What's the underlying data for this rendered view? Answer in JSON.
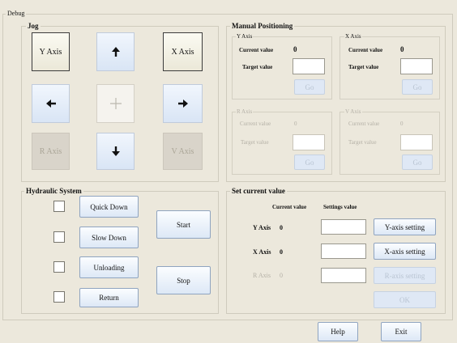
{
  "debug": {
    "title": "Debug"
  },
  "jog": {
    "title": "Jog",
    "y_axis": "Y Axis",
    "x_axis": "X Axis",
    "r_axis": "R Axis",
    "v_axis": "V Axis",
    "up_icon": "arrow-up-icon",
    "left_icon": "arrow-left-icon",
    "center_icon": "plus-icon",
    "right_icon": "arrow-right-icon",
    "down_icon": "arrow-down-icon"
  },
  "manual": {
    "title": "Manual Positioning",
    "y": {
      "title": "Y Axis",
      "current_label": "Current value",
      "current_value": "0",
      "target_label": "Target value",
      "target_value": "",
      "go": "Go"
    },
    "x": {
      "title": "X Axis",
      "current_label": "Current value",
      "current_value": "0",
      "target_label": "Target value",
      "target_value": "",
      "go": "Go"
    },
    "r": {
      "title": "R Axis",
      "current_label": "Current value",
      "current_value": "0",
      "target_label": "Target value",
      "target_value": "",
      "go": "Go"
    },
    "v": {
      "title": "V Axis",
      "current_label": "Current value",
      "current_value": "0",
      "target_label": "Target value",
      "target_value": "",
      "go": "Go"
    }
  },
  "hydraulic": {
    "title": "Hydraulic System",
    "quick_down": "Quick Down",
    "slow_down": "Slow Down",
    "unloading": "Unloading",
    "return": "Return",
    "start": "Start",
    "stop": "Stop"
  },
  "setcur": {
    "title": "Set current value",
    "col_current": "Current value",
    "col_settings": "Settings value",
    "y_label": "Y Axis",
    "y_value": "0",
    "y_btn": "Y-axis setting",
    "x_label": "X Axis",
    "x_value": "0",
    "x_btn": "X-axis setting",
    "r_label": "R Axis",
    "r_value": "0",
    "r_btn": "R-axis setting",
    "ok": "OK"
  },
  "footer": {
    "help": "Help",
    "exit": "Exit"
  },
  "colors": {
    "background": "#ece8dc",
    "button": "#dde8f6",
    "button_border": "#8fa4c0",
    "disabled_text": "#b4b0a6"
  }
}
